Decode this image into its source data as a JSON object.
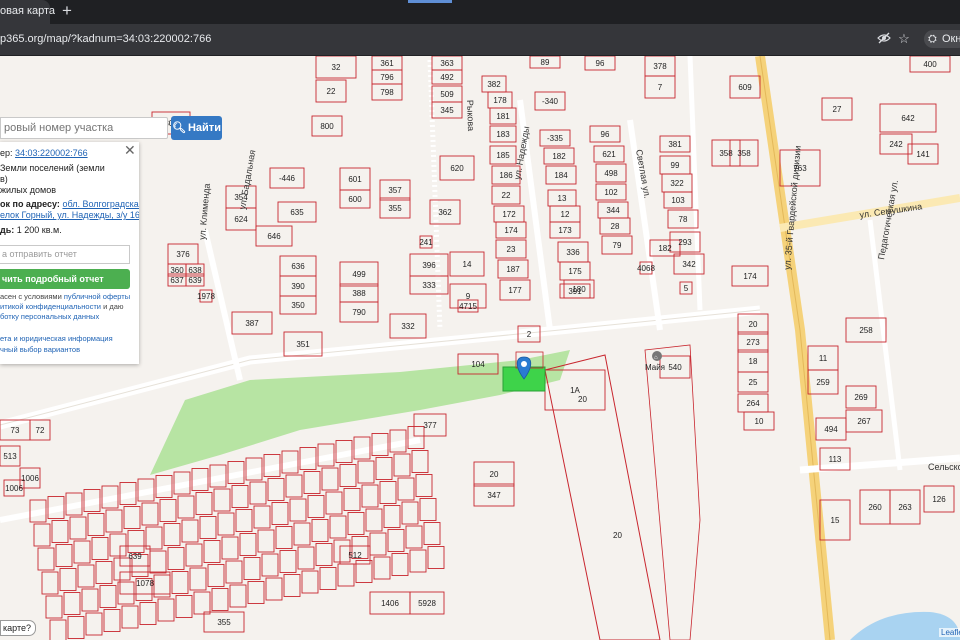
{
  "browser": {
    "tab_title": "овая карта",
    "tab_close": "✕",
    "new_tab": "+",
    "url": "p365.org/map/?kadnum=34:03:220002:766",
    "profile_label": "Окн",
    "icons": [
      "eye-off-icon",
      "star-icon",
      "profile-icon"
    ]
  },
  "search": {
    "placeholder": "ровый номер участка",
    "button_label": "Найти",
    "button_icon": "search-icon"
  },
  "info_panel": {
    "number_label": "ер:",
    "number_value": "34:03:220002:766",
    "category_line1": "Земли поселений (земли",
    "category_line2": "в)",
    "usage_line": "жилых домов",
    "address_label": "ок по адресу:",
    "address_line1": "обл. Волгоградская, г",
    "address_line2": "елок Горный, ул. Надежды, з/у 16",
    "area_label": "дь:",
    "area_value": "1 200 кв.м.",
    "email_placeholder": "а отправить отчет",
    "report_button": "чить подробный отчет",
    "terms_line1_a": "асен с условиями ",
    "terms_line1_link": "публичной оферты",
    "terms_line2_link": "итикой конфиденциальности",
    "terms_line2_b": " и даю",
    "terms_line3_link": "ботку персональных данных",
    "link1": "ета и юридическая информация",
    "link2": "чный выбор вариантов",
    "close_icon": "close-icon"
  },
  "map": {
    "selected_color": "#3ed34a",
    "plot_stroke": "#c8262e",
    "green_zone_color": "#aee29b",
    "marker_color": "#2a7bd1",
    "streets": [
      {
        "label": "ул. Надежды"
      },
      {
        "label": "ул. Бадальная"
      },
      {
        "label": "ул. Клименда"
      },
      {
        "label": "Светлая ул."
      },
      {
        "label": "Рыкова"
      },
      {
        "label": "ул. Семушкина"
      },
      {
        "label": "ул. 35-й Гвардейской дивизии"
      },
      {
        "label": "Педагогическая ул."
      },
      {
        "label": "Сельско"
      }
    ],
    "poi_label": "Майя",
    "plot_labels": [
      "361",
      "796",
      "798",
      "363",
      "492",
      "509",
      "345",
      "382",
      "178",
      "181",
      "183",
      "185",
      "186",
      "22",
      "172",
      "174",
      "23",
      "187",
      "177",
      "89",
      "96",
      "-340",
      "-335",
      "182",
      "184",
      "13",
      "12",
      "173",
      "336",
      "175",
      "180",
      "96",
      "621",
      "498",
      "102",
      "344",
      "28",
      "79",
      "378",
      "7",
      "609",
      "381",
      "99",
      "322",
      "103",
      "78",
      "293",
      "342",
      "358",
      "358",
      "763",
      "27",
      "642",
      "242",
      "141",
      "400",
      "306",
      "800",
      "32",
      "22",
      "-446",
      "601",
      "600",
      "357",
      "355",
      "354",
      "624",
      "635",
      "646",
      "376",
      "360",
      "638",
      "637",
      "639",
      "636",
      "390",
      "350",
      "499",
      "388",
      "790",
      "396",
      "333",
      "332",
      "387",
      "351",
      "620",
      "362",
      "14",
      "9",
      "4715",
      "391",
      "2",
      "104",
      "1A",
      "377",
      "20",
      "347",
      "182",
      "174",
      "20",
      "273",
      "18",
      "25",
      "264",
      "10",
      "11",
      "259",
      "258",
      "269",
      "267",
      "494",
      "113",
      "126",
      "263",
      "260",
      "15",
      "73",
      "72",
      "513",
      "1006",
      "1006",
      "1078",
      "639",
      "512",
      "1406",
      "5928",
      "355",
      "540",
      "1978",
      "4068",
      "241",
      "5",
      "3",
      "4",
      "3"
    ],
    "leaflet": "Leaflet",
    "help_chip": "карте?"
  }
}
